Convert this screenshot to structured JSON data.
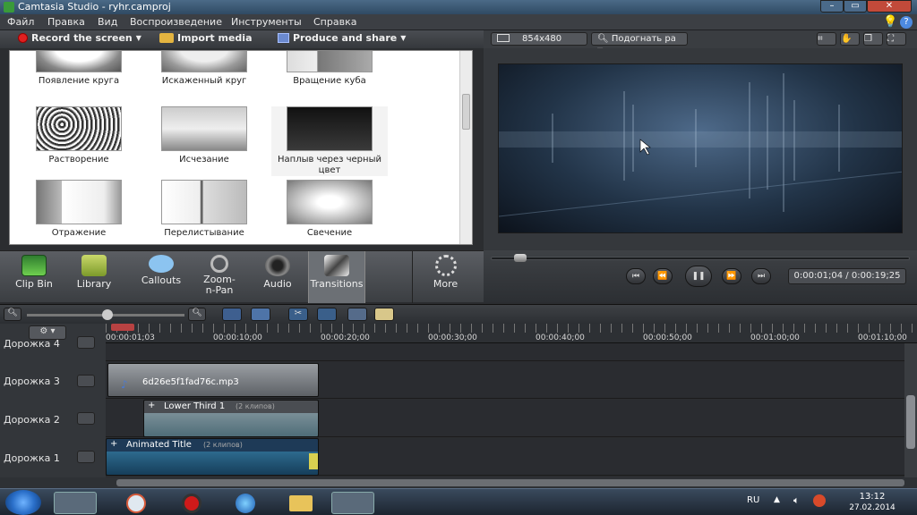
{
  "window": {
    "title": "Camtasia Studio - ryhr.camproj"
  },
  "menu": [
    "Файл",
    "Правка",
    "Вид",
    "Воспроизведение",
    "Инструменты",
    "Справка"
  ],
  "toolbar": {
    "record": "Record the screen",
    "import": "Import media",
    "produce": "Produce and share"
  },
  "transitions": [
    {
      "label": "Появление круга"
    },
    {
      "label": "Искаженный круг"
    },
    {
      "label": "Вращение куба"
    },
    {
      "label": "Растворение"
    },
    {
      "label": "Исчезание"
    },
    {
      "label": "Наплыв через черный цвет"
    },
    {
      "label": "Отражение"
    },
    {
      "label": "Перелистывание"
    },
    {
      "label": "Свечение"
    }
  ],
  "tabs": [
    {
      "label": "Clip Bin"
    },
    {
      "label": "Library"
    },
    {
      "label": "Callouts"
    },
    {
      "label": "Zoom-n-Pan"
    },
    {
      "label": "Audio"
    },
    {
      "label": "Transitions"
    },
    {
      "label": "More"
    }
  ],
  "preview": {
    "resolution": "854x480",
    "fit": "Подогнать ра",
    "timecode": "0:00:01;04 / 0:00:19;25"
  },
  "timeline": {
    "ruler": [
      "00:00:01;03",
      "00:00:10;00",
      "00:00:20;00",
      "00:00:30;00",
      "00:00:40;00",
      "00:00:50;00",
      "00:01:00;00",
      "00:01:10;00"
    ],
    "tracks": [
      "Дорожка 4",
      "Дорожка 3",
      "Дорожка 2",
      "Дорожка 1"
    ],
    "clips": {
      "audio": "6d26e5f1fad76c.mp3",
      "lower_third": "Lower Third 1",
      "lower_third_count": "(2 клипов)",
      "animated_title": "Animated Title",
      "animated_title_count": "(2 клипов)"
    }
  },
  "taskbar": {
    "lang": "RU",
    "time": "13:12",
    "date": "27.02.2014"
  }
}
